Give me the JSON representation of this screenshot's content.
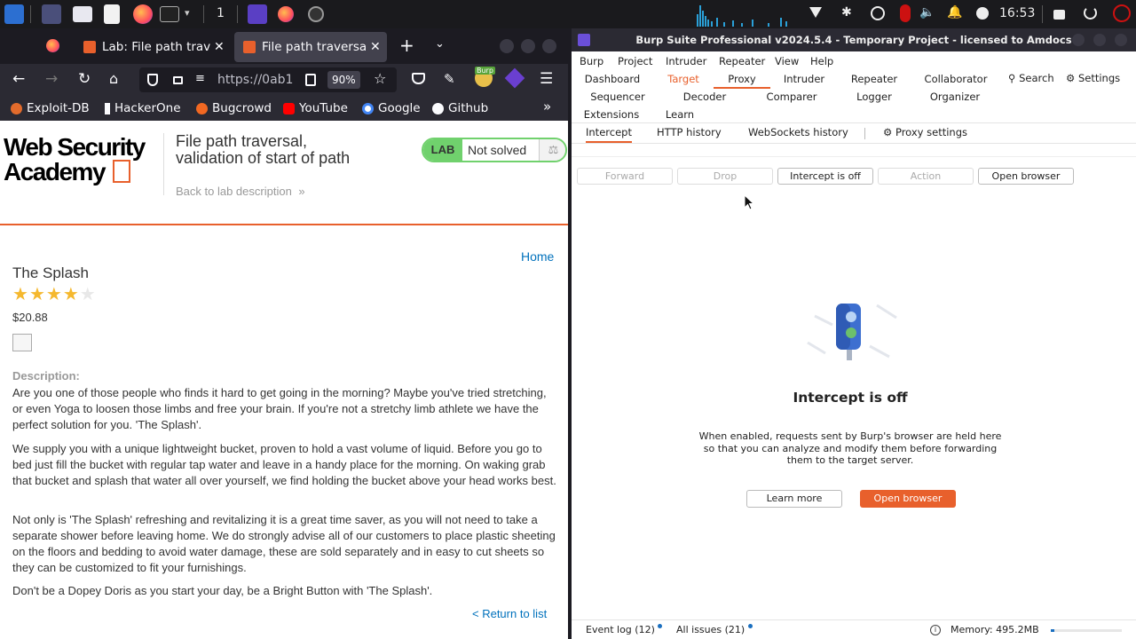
{
  "taskbar": {
    "workspace": "1",
    "clock": "16:53"
  },
  "firefox": {
    "tabs": [
      {
        "title": "Lab: File path trave"
      },
      {
        "title": "File path traversal"
      }
    ],
    "url": "https://0ab1",
    "zoom": "90%",
    "bookmarks": [
      "Exploit-DB",
      "HackerOne",
      "Bugcrowd",
      "YouTube",
      "Google",
      "Github"
    ]
  },
  "lab": {
    "logo_line1": "Web Security",
    "logo_line2": "Academy",
    "title_line1": "File path traversal,",
    "title_line2": "validation of start of path",
    "badge": "LAB",
    "status": "Not solved",
    "back_link": "Back to lab description",
    "home_link": "Home",
    "product_name": "The Splash",
    "rating": 4,
    "rating_max": 5,
    "price": "$20.88",
    "description_label": "Description:",
    "paragraphs": [
      "Are you one of those people who finds it hard to get going in the morning? Maybe you've tried stretching, or even Yoga to loosen those limbs and free your brain. If you're not a stretchy limb athlete we have the perfect solution for you. 'The Splash'.",
      "We supply you with a unique lightweight bucket, proven to hold a vast volume of liquid. Before you go to bed just fill the bucket with regular tap water and leave in a handy place for the morning. On waking grab that bucket and splash that water all over yourself, we find holding the bucket above your head works best.",
      "Not only is 'The Splash' refreshing and revitalizing it is a great time saver, as you will not need to take a separate shower before leaving home. We do strongly advise all of our customers to place plastic sheeting on the floors and bedding to avoid water damage, these are sold separately and in easy to cut sheets so they can be customized to fit your furnishings.",
      "Don't be a Dopey Doris as you start your day, be a Bright Button with 'The Splash'."
    ],
    "return_link": "< Return to list"
  },
  "burp": {
    "title": "Burp Suite Professional v2024.5.4 - Temporary Project - licensed to Amdocs",
    "menu": [
      "Burp",
      "Project",
      "Intruder",
      "Repeater",
      "View",
      "Help"
    ],
    "tools_row1": [
      "Dashboard",
      "Target",
      "Proxy",
      "Intruder",
      "Repeater",
      "Collaborator"
    ],
    "search": "Search",
    "settings": "Settings",
    "tools_row2": [
      "Sequencer",
      "Decoder",
      "Comparer",
      "Logger",
      "Organizer"
    ],
    "tools_row3": [
      "Extensions",
      "Learn"
    ],
    "subtabs": [
      "Intercept",
      "HTTP history",
      "WebSockets history"
    ],
    "proxy_settings": "Proxy settings",
    "buttons": [
      "Forward",
      "Drop",
      "Intercept is off",
      "Action",
      "Open browser"
    ],
    "heading": "Intercept is off",
    "desc_lines": [
      "When enabled, requests sent by Burp's browser are held here",
      "so that you can analyze and modify them before forwarding",
      "them to the target server."
    ],
    "learn_more": "Learn more",
    "open_browser": "Open browser",
    "event_log": "Event log (12)",
    "all_issues": "All issues (21)",
    "memory": "Memory: 495.2MB",
    "colors": {
      "accent": "#e8602c",
      "link": "#1a6fc0"
    }
  }
}
